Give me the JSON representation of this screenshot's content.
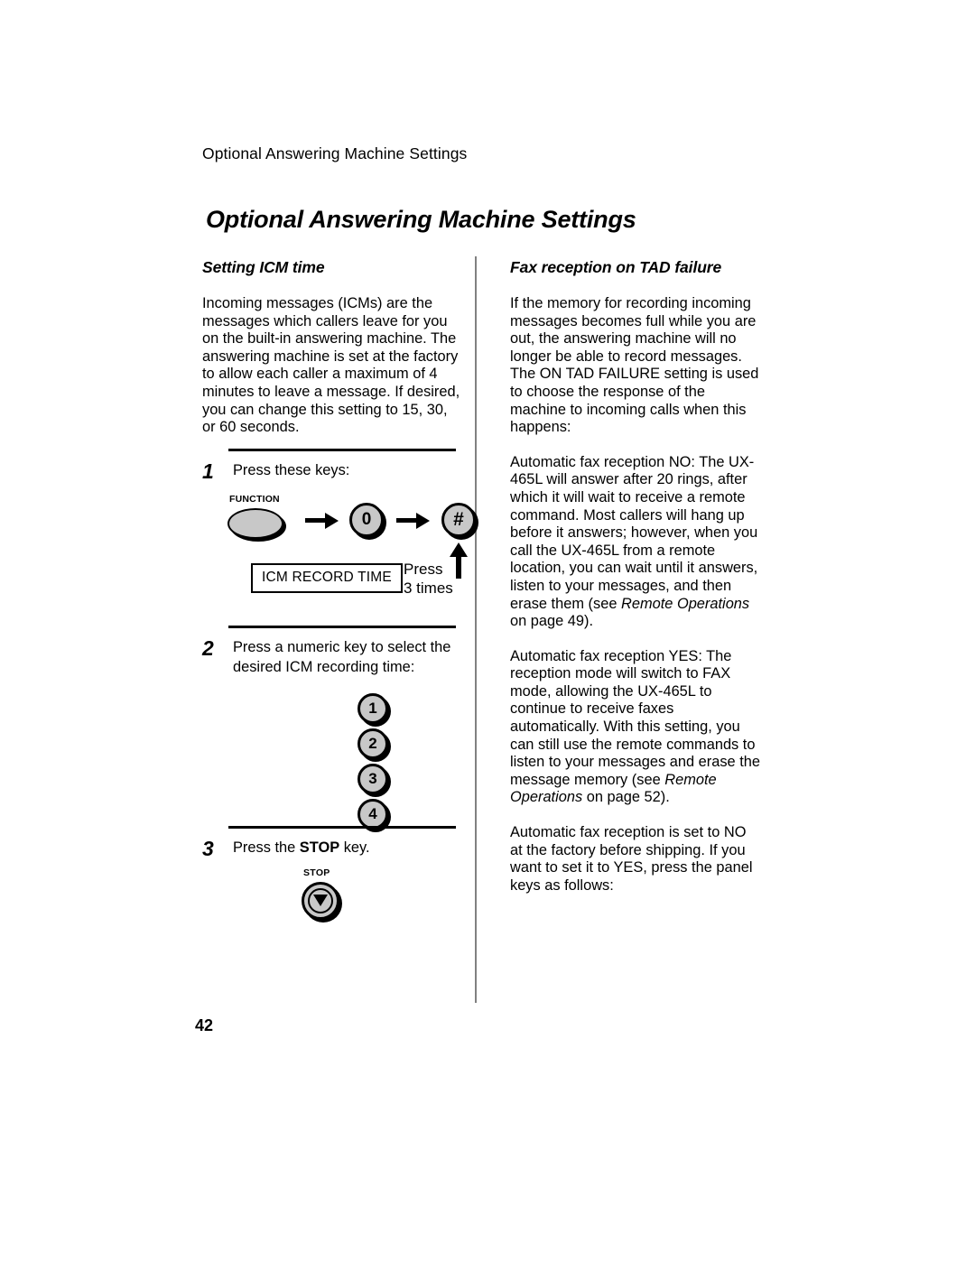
{
  "page": {
    "running_header": "Optional Answering Machine Settings",
    "chapter_title": "Optional Answering Machine Settings",
    "page_number": "42"
  },
  "left_column": {
    "heading": "Setting ICM time",
    "intro": "Incoming messages (ICMs) are the messages which callers leave for you on the built-in answering machine. The answering machine is set at the factory to allow each caller a maximum of 4 minutes to leave a message. If desired, you can change this setting to 15, 30, or 60 seconds.",
    "steps": [
      {
        "number": "1",
        "text": "Press these keys:",
        "keys": {
          "function_caption": "FUNCTION",
          "key_zero": "0",
          "key_hash": "#",
          "display": "ICM RECORD TIME",
          "press_line1": "Press",
          "press_line2": "3 times"
        }
      },
      {
        "number": "2",
        "text": "Press a numeric key to select the desired ICM recording time:",
        "numeric_keys": [
          "1",
          "2",
          "3",
          "4"
        ]
      },
      {
        "number": "3",
        "text_before": "Press the ",
        "text_bold": "STOP",
        "text_after": " key.",
        "stop_caption": "STOP"
      }
    ]
  },
  "right_column": {
    "heading": "Fax reception on TAD failure",
    "paragraphs": [
      "If the memory for recording incoming messages becomes full while you are out, the answering machine will no longer be able to record messages. The ON TAD FAILURE setting is used to choose the response of the machine to incoming calls when this happens:",
      "Automatic fax reception is set to NO at the factory before shipping. If you want to set it to YES, press the panel keys as follows:"
    ],
    "para_no_before": "Automatic fax reception NO: The UX-465L will answer after 20 rings, after which it will wait to receive a remote command. Most callers will hang up before it answers; however, when you call the UX-465L from a remote location, you can wait until it answers, listen to your messages, and then erase them (see ",
    "para_no_italic": "Remote Operations",
    "para_no_after": " on page 49).",
    "para_yes_before": "Automatic fax reception YES: The reception mode will switch to FAX mode, allowing the UX-465L to continue to receive faxes automatically. With this setting, you can still use the remote commands to listen to your messages and erase the message memory (see ",
    "para_yes_italic": "Remote Operations",
    "para_yes_after": " on page 52)."
  }
}
